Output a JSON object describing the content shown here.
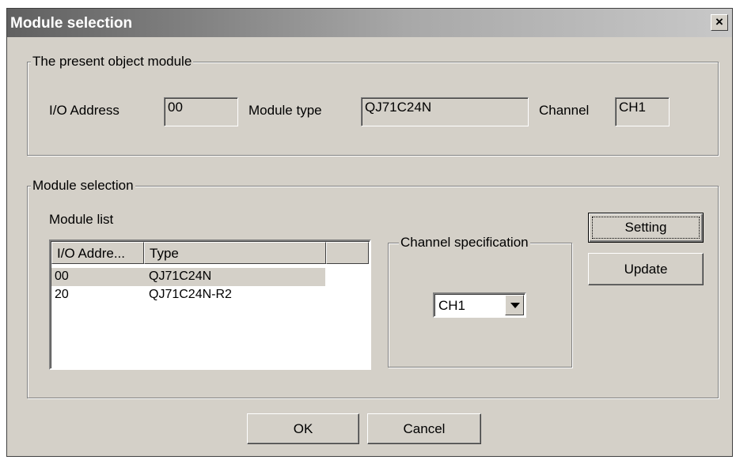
{
  "window": {
    "title": "Module selection",
    "close_symbol": "×"
  },
  "present": {
    "legend": "The present object module",
    "io_label": "I/O Address",
    "io_value": "00",
    "type_label": "Module type",
    "type_value": "QJ71C24N",
    "channel_label": "Channel",
    "channel_value": "CH1"
  },
  "selection": {
    "legend": "Module selection",
    "list_label": "Module list",
    "columns": [
      "I/O Addre...",
      "Type"
    ],
    "rows": [
      {
        "io": "00",
        "type": "QJ71C24N",
        "selected": true
      },
      {
        "io": "20",
        "type": "QJ71C24N-R2",
        "selected": false
      }
    ],
    "channel_legend": "Channel specification",
    "channel_selected": "CH1",
    "setting_label": "Setting",
    "update_label": "Update"
  },
  "footer": {
    "ok_label": "OK",
    "cancel_label": "Cancel"
  }
}
